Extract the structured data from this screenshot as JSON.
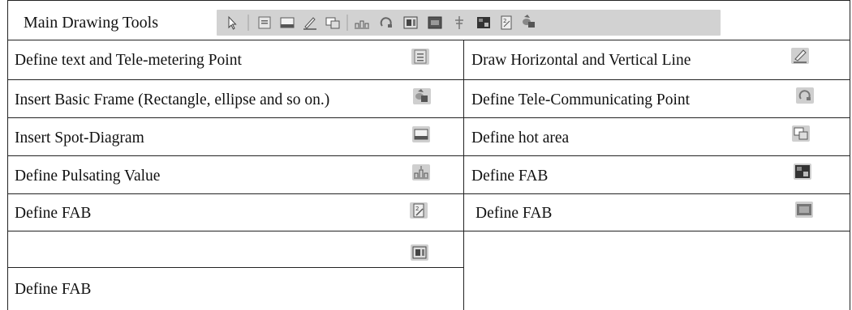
{
  "header": {
    "title": "Main Drawing Tools",
    "toolbar_icons": [
      "pointer-icon",
      "text-box-icon",
      "spot-diagram-icon",
      "pen-line-icon",
      "hot-area-icon",
      "pulse-value-icon",
      "tele-communicating-icon",
      "fab-panel-icon",
      "fab-image-icon",
      "fab-plug-icon",
      "fab-dark-icon",
      "fab-doc-icon",
      "basic-frame-icon"
    ]
  },
  "rows": [
    {
      "left": "Define text and Tele-metering Point",
      "left_icon": "text-box-icon",
      "right": "Draw Horizontal and Vertical Line",
      "right_icon": "pen-line-icon"
    },
    {
      "left": "Insert Basic Frame (Rectangle, ellipse and so on.)",
      "left_icon": "basic-frame-icon",
      "right": "Define Tele-Communicating Point",
      "right_icon": "tele-communicating-icon"
    },
    {
      "left": "Insert Spot-Diagram",
      "left_icon": "spot-diagram-icon",
      "right": "Define hot area",
      "right_icon": "hot-area-icon"
    },
    {
      "left": "Define Pulsating Value",
      "left_icon": "pulse-value-icon",
      "right": "Define FAB",
      "right_icon": "fab-dark-icon"
    },
    {
      "left": "Define FAB",
      "left_icon": "fab-doc-icon",
      "right": "Define FAB",
      "right_icon": "fab-image-icon"
    },
    {
      "left": "Define FAB",
      "left_icon": "fab-panel-icon",
      "right": "",
      "right_icon": ""
    }
  ],
  "colors": {
    "border": "#222222",
    "toolbar_bg": "#d2d2d2",
    "icon_bg": "#cfcfcf"
  }
}
